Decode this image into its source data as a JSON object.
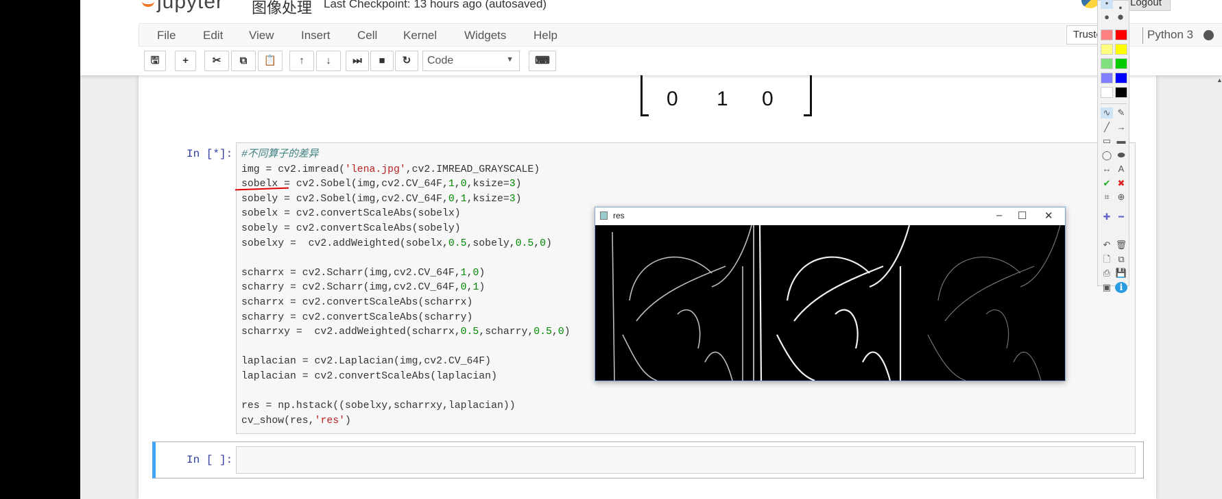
{
  "header": {
    "logo_text": "jupyter",
    "notebook_title": "图像处理",
    "checkpoint": "Last Checkpoint: 13 hours ago (autosaved)",
    "logout_label": "Logout"
  },
  "menu": [
    "File",
    "Edit",
    "View",
    "Insert",
    "Cell",
    "Kernel",
    "Widgets",
    "Help"
  ],
  "status": {
    "trusted": "Trusted",
    "kernel": "Python 3"
  },
  "toolbar": {
    "cell_type": "Code",
    "buttons": [
      "save",
      "insert-below",
      "cut",
      "copy",
      "paste",
      "move-up",
      "move-down",
      "run",
      "interrupt",
      "restart",
      "command-palette"
    ]
  },
  "matrix_row": [
    "0",
    "1",
    "0"
  ],
  "cell1": {
    "prompt": "In [*]:",
    "lines": [
      "#不同算子的差异",
      "img = cv2.imread('lena.jpg',cv2.IMREAD_GRAYSCALE)",
      "sobelx = cv2.Sobel(img,cv2.CV_64F,1,0,ksize=3)",
      "sobely = cv2.Sobel(img,cv2.CV_64F,0,1,ksize=3)",
      "sobelx = cv2.convertScaleAbs(sobelx)",
      "sobely = cv2.convertScaleAbs(sobely)",
      "sobelxy =  cv2.addWeighted(sobelx,0.5,sobely,0.5,0)",
      "",
      "scharrx = cv2.Scharr(img,cv2.CV_64F,1,0)",
      "scharry = cv2.Scharr(img,cv2.CV_64F,0,1)",
      "scharrx = cv2.convertScaleAbs(scharrx)",
      "scharry = cv2.convertScaleAbs(scharry)",
      "scharrxy =  cv2.addWeighted(scharrx,0.5,scharry,0.5,0)",
      "",
      "laplacian = cv2.Laplacian(img,cv2.CV_64F)",
      "laplacian = cv2.convertScaleAbs(laplacian)",
      "",
      "res = np.hstack((sobelxy,scharrxy,laplacian))",
      "cv_show(res,'res')"
    ]
  },
  "cell2": {
    "prompt": "In [ ]:"
  },
  "image_window": {
    "title": "res",
    "minimize": "–",
    "maximize": "☐",
    "close": "✕"
  },
  "palette": {
    "colors": [
      "#ff8080",
      "#ff0000",
      "#ffff80",
      "#ffff00",
      "#80e080",
      "#00cc00",
      "#8080ff",
      "#0000ff",
      "#ffffff",
      "#000000"
    ],
    "accent": "#42a5f5"
  }
}
